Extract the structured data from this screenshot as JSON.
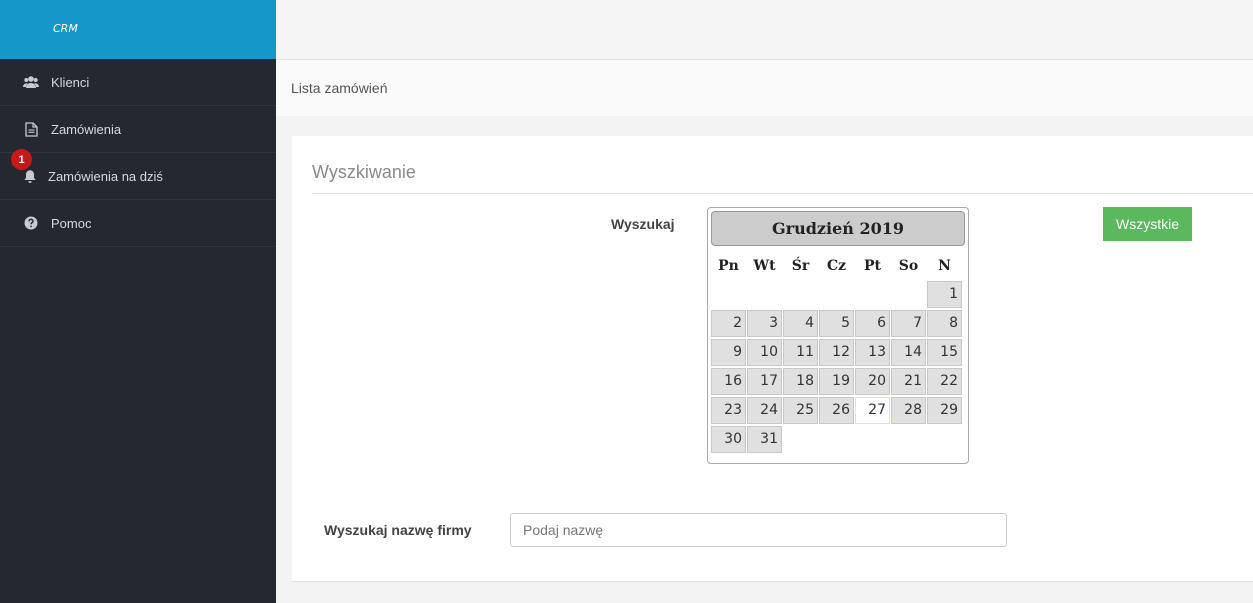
{
  "brand": "CRM",
  "sidebar": {
    "items": [
      {
        "label": "Klienci",
        "icon": "users-icon"
      },
      {
        "label": "Zamówienia",
        "icon": "document-icon"
      },
      {
        "label": "Zamówienia na dziś",
        "icon": "bell-icon",
        "badge": "1"
      },
      {
        "label": "Pomoc",
        "icon": "question-circle-icon"
      }
    ]
  },
  "breadcrumb": "Lista zamówień",
  "search_panel": {
    "title": "Wyszkiwanie",
    "search_label": "Wyszukaj",
    "all_button": "Wszystkie",
    "company_label": "Wyszukaj nazwę firmy",
    "company_placeholder": "Podaj nazwę"
  },
  "calendar": {
    "month_label": "Grudzień 2019",
    "weekdays": [
      "Pn",
      "Wt",
      "Śr",
      "Cz",
      "Pt",
      "So",
      "N"
    ],
    "days": [
      "1",
      "2",
      "3",
      "4",
      "5",
      "6",
      "7",
      "8",
      "9",
      "10",
      "11",
      "12",
      "13",
      "14",
      "15",
      "16",
      "17",
      "18",
      "19",
      "20",
      "21",
      "22",
      "23",
      "24",
      "25",
      "26",
      "27",
      "28",
      "29",
      "30",
      "31"
    ],
    "today": "27"
  },
  "colors": {
    "brand": "#1697c9",
    "sidebar": "#252830",
    "button_green": "#5cb85c",
    "badge_red": "#c41a1a"
  }
}
